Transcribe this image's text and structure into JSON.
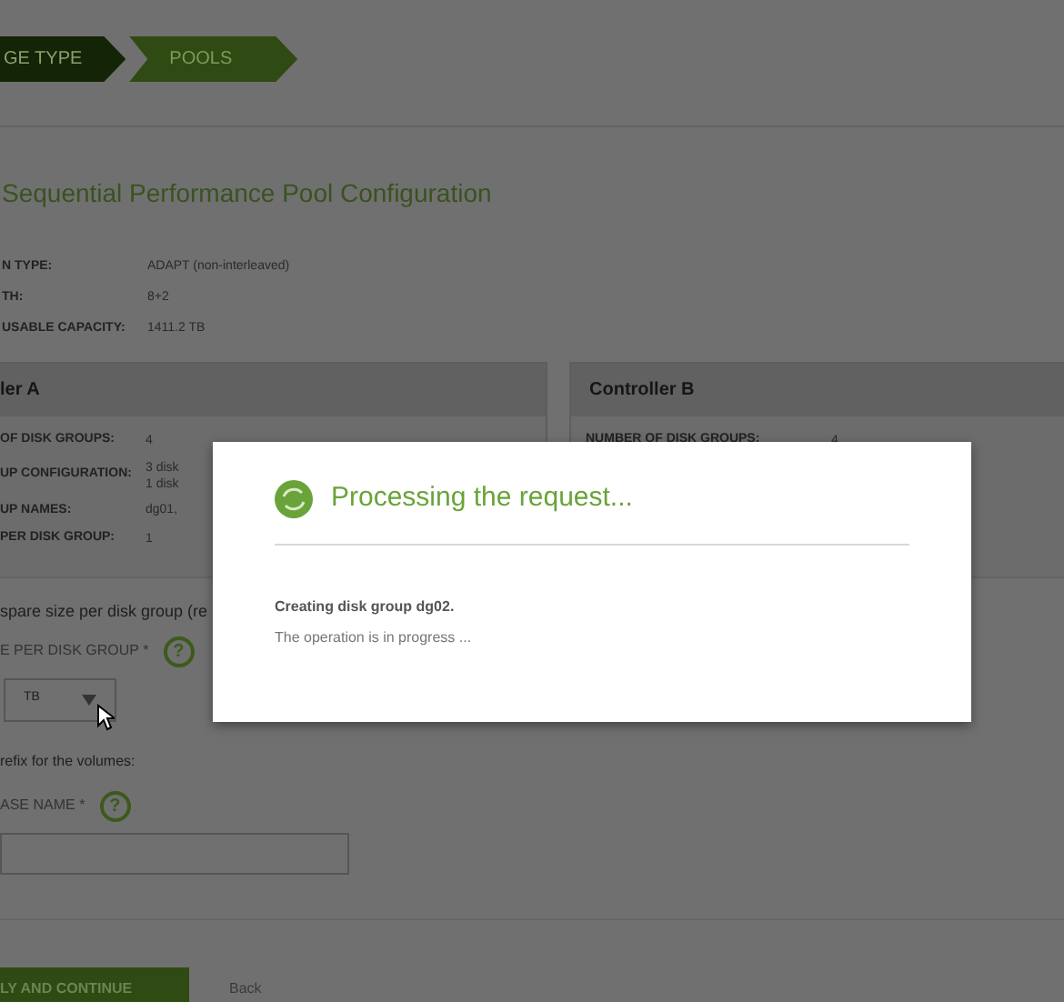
{
  "steps": [
    {
      "label": "GE TYPE",
      "selected": false
    },
    {
      "label": "POOLS",
      "selected": true
    }
  ],
  "title": "Sequential Performance Pool Configuration",
  "summary": [
    {
      "label": "N TYPE:",
      "value": "ADAPT (non-interleaved)"
    },
    {
      "label": "TH:",
      "value": "8+2"
    },
    {
      "label": "USABLE CAPACITY:",
      "value": "1411.2 TB"
    }
  ],
  "controllers": [
    {
      "title": "ler A",
      "rows": [
        {
          "label": "OF DISK GROUPS:",
          "value": "4"
        },
        {
          "label": "UP CONFIGURATION:",
          "value": "3 disk\n1 disk"
        },
        {
          "label": "UP NAMES:",
          "value": "dg01,"
        },
        {
          "label": "PER DISK GROUP:",
          "value": "1"
        }
      ]
    },
    {
      "title": "Controller B",
      "rows": [
        {
          "label": "NUMBER OF DISK GROUPS:",
          "value": "4"
        }
      ]
    }
  ],
  "spare": {
    "prompt": "spare size per disk group (re",
    "label": "E PER DISK GROUP",
    "required": "*",
    "unit": "TB"
  },
  "prefix": {
    "prompt": "refix for the volumes:",
    "label": "ASE NAME",
    "required": "*"
  },
  "help": "?",
  "actions": {
    "primary": "LY AND CONTINUE",
    "back": "Back"
  },
  "dialog": {
    "title": "Processing the request...",
    "message": "Creating disk group dg02.",
    "status": "The operation is in progress ..."
  }
}
